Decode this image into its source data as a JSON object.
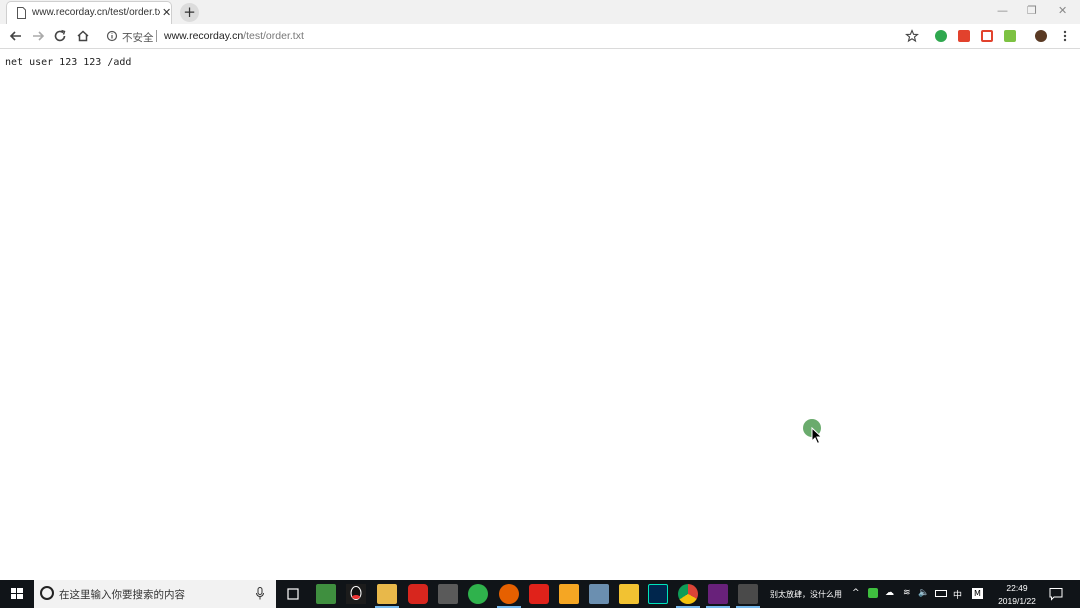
{
  "browser": {
    "tab": {
      "title": "www.recorday.cn/test/order.txt",
      "close_glyph": "✕"
    },
    "new_tab_glyph": "+",
    "window_controls": {
      "minimize": "—",
      "restore": "❐",
      "close": "✕"
    },
    "address_bar": {
      "security_label": "不安全",
      "url_host": "www.recorday.cn",
      "url_path": "/test/order.txt"
    }
  },
  "page": {
    "content": "net user 123 123 /add"
  },
  "taskbar": {
    "search_placeholder": "在这里输入你要搜索的内容",
    "pinned_apps": [
      "task-view-icon",
      "file-icon",
      "qq-icon",
      "file-explorer-icon",
      "netease-music-icon",
      "screenshot-icon",
      "wechat-icon",
      "firefox-icon",
      "youdao-icon",
      "fl-studio-icon",
      "monitor-icon",
      "folder-icon",
      "adobe-audition-icon",
      "chrome-icon",
      "visual-studio-icon",
      "display-icon"
    ],
    "tray_notice": "别太放肆，没什么用",
    "input_method": "中",
    "clock_time": "22:49",
    "clock_date": "2019/1/22"
  },
  "colors": {
    "tab_strip": "#f1f1f1",
    "taskbar": "#101418",
    "click_indicator": "#6aab6d",
    "active_underline": "#76b9ed"
  }
}
